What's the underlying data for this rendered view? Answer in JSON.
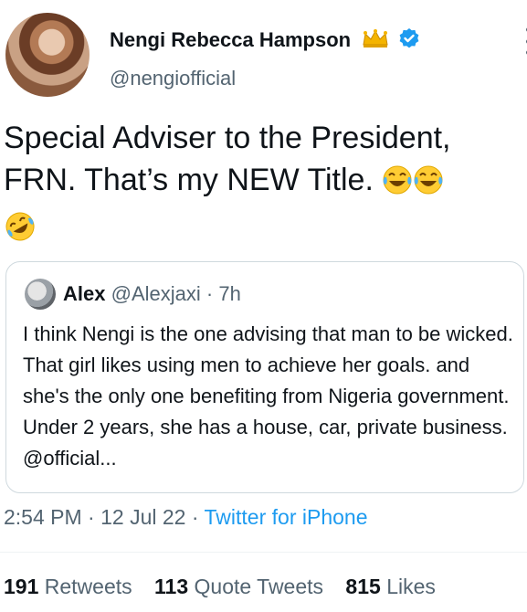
{
  "author": {
    "display_name": "Nengi Rebecca Hampson",
    "handle": "@nengiofficial",
    "icons": [
      "crown-icon",
      "verified-badge-icon"
    ],
    "verified_color": "#1d9bf0"
  },
  "tweet": {
    "text_line1": "Special Adviser to the President,",
    "text_line2": "FRN. That’s my NEW Title.",
    "emojis": [
      "face-with-tears-of-joy",
      "face-with-tears-of-joy",
      "rolling-on-the-floor-laughing"
    ]
  },
  "quote": {
    "name": "Alex",
    "handle": "@Alexjaxi",
    "separator": "·",
    "time": "7h",
    "text": "I think Nengi is the  one advising that man to be wicked. That girl likes using men to achieve her goals. and she's the only one benefiting from Nigeria government. Under 2 years, she has a house, car, private business. @official..."
  },
  "meta": {
    "time": "2:54 PM",
    "separator": "·",
    "date": "12 Jul 22",
    "separator2": "·",
    "source": "Twitter for iPhone"
  },
  "stats": {
    "retweets_count": "191",
    "retweets_label": "Retweets",
    "quotes_count": "113",
    "quotes_label": "Quote Tweets",
    "likes_count": "815",
    "likes_label": "Likes"
  },
  "colors": {
    "link": "#1d9bf0",
    "secondary_text": "#536471",
    "text": "#0f1419"
  }
}
